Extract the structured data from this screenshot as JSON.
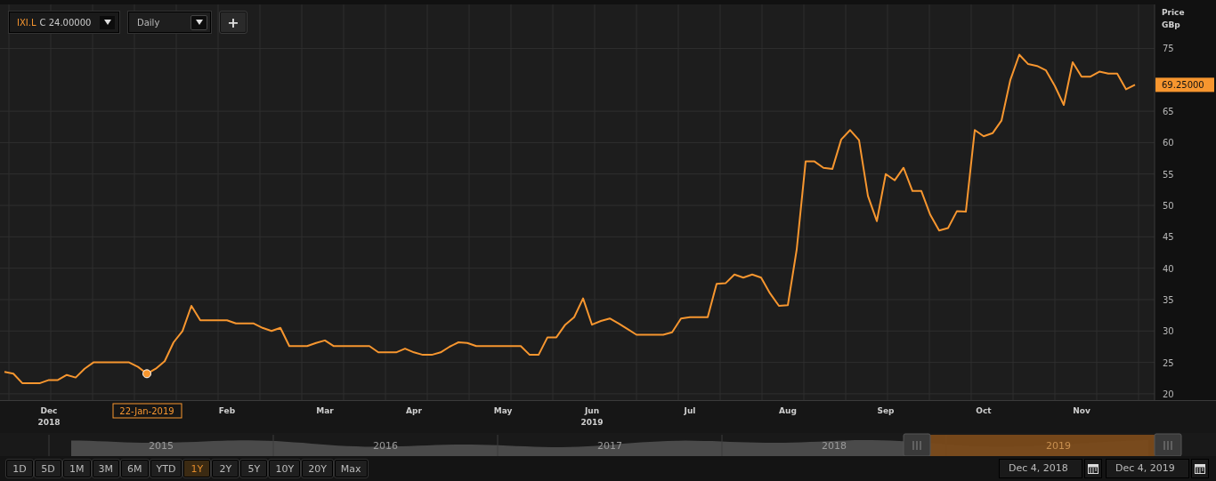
{
  "toolbar": {
    "symbol": "IXI.L",
    "quote": "C 24.00000",
    "interval": "Daily",
    "add_button": "+"
  },
  "chart": {
    "axis_title": "Price",
    "axis_unit": "GBp",
    "last_price": "69.25000",
    "chart_data": {
      "type": "line",
      "ylim": [
        19,
        82
      ],
      "grid": true,
      "categories": [
        null,
        null,
        null,
        null,
        null,
        "Dec 2018",
        null,
        null,
        null,
        null,
        null,
        null,
        null,
        null,
        null,
        null,
        null,
        null,
        null,
        null,
        null,
        null,
        null,
        null,
        null,
        "Feb",
        null,
        null,
        null,
        null,
        null,
        null,
        null,
        null,
        null,
        null,
        "Mar",
        null,
        null,
        null,
        null,
        null,
        null,
        null,
        null,
        null,
        "Apr",
        null,
        null,
        null,
        null,
        null,
        null,
        null,
        null,
        null,
        "May",
        null,
        null,
        null,
        null,
        null,
        null,
        null,
        null,
        null,
        "Jun 2019",
        null,
        null,
        null,
        null,
        null,
        null,
        null,
        null,
        null,
        null,
        "Jul",
        null,
        null,
        null,
        null,
        null,
        null,
        null,
        null,
        null,
        null,
        "Aug",
        null,
        null,
        null,
        null,
        null,
        null,
        null,
        null,
        null,
        null,
        "Sep",
        null,
        null,
        null,
        null,
        null,
        null,
        null,
        null,
        null,
        null,
        "Oct",
        null,
        null,
        null,
        null,
        null,
        null,
        null,
        null,
        null,
        null,
        "Nov",
        null,
        null,
        null,
        null,
        null,
        null
      ],
      "series": [
        {
          "color": "#f7962f",
          "values": [
            23.5,
            23.2,
            21.7,
            21.7,
            21.7,
            22.2,
            22.2,
            23,
            22.6,
            24,
            25,
            25,
            25,
            25,
            25,
            24.3,
            23.2,
            24,
            25.2,
            28.2,
            30,
            34,
            31.7,
            31.7,
            31.7,
            31.7,
            31.2,
            31.2,
            31.2,
            30.5,
            30,
            30.5,
            27.6,
            27.6,
            27.6,
            28.1,
            28.5,
            27.6,
            27.6,
            27.6,
            27.6,
            27.6,
            26.6,
            26.6,
            26.6,
            27.2,
            26.6,
            26.2,
            26.2,
            26.6,
            27.5,
            28.2,
            28.1,
            27.6,
            27.6,
            27.6,
            27.6,
            27.6,
            27.6,
            26.2,
            26.2,
            29,
            29,
            31,
            32.2,
            35.2,
            31,
            31.6,
            32,
            31.2,
            30.3,
            29.4,
            29.4,
            29.4,
            29.4,
            29.8,
            32,
            32.2,
            32.2,
            32.2,
            37.5,
            37.6,
            39,
            38.5,
            39,
            38.5,
            36,
            34,
            34.1,
            43,
            57,
            57,
            56,
            55.8,
            60.5,
            62,
            60.4,
            51.5,
            47.5,
            55,
            54,
            56,
            52.3,
            52.3,
            48.5,
            46,
            46.4,
            49.1,
            49,
            62,
            61,
            61.5,
            63.5,
            70,
            74,
            72.5,
            72.2,
            71.5,
            69,
            66,
            72.8,
            70.5,
            70.5,
            71.3,
            71,
            71,
            68.5,
            69.2
          ]
        }
      ],
      "yticks": [
        20,
        25,
        30,
        35,
        40,
        45,
        50,
        55,
        60,
        65,
        75
      ],
      "annotations": [
        "22-Jan-2019"
      ]
    }
  },
  "navigator": {
    "years": [
      {
        "label": "2015",
        "selected": false
      },
      {
        "label": "2016",
        "selected": false
      },
      {
        "label": "2017",
        "selected": false
      },
      {
        "label": "2018",
        "selected": false
      },
      {
        "label": "2019",
        "selected": true
      }
    ]
  },
  "ranges": [
    {
      "label": "1D",
      "selected": false
    },
    {
      "label": "5D",
      "selected": false
    },
    {
      "label": "1M",
      "selected": false
    },
    {
      "label": "3M",
      "selected": false
    },
    {
      "label": "6M",
      "selected": false
    },
    {
      "label": "YTD",
      "selected": false
    },
    {
      "label": "1Y",
      "selected": true
    },
    {
      "label": "2Y",
      "selected": false
    },
    {
      "label": "5Y",
      "selected": false
    },
    {
      "label": "10Y",
      "selected": false
    },
    {
      "label": "20Y",
      "selected": false
    },
    {
      "label": "Max",
      "selected": false
    }
  ],
  "dates": {
    "from": "Dec 4, 2018",
    "to": "Dec 4, 2019"
  }
}
